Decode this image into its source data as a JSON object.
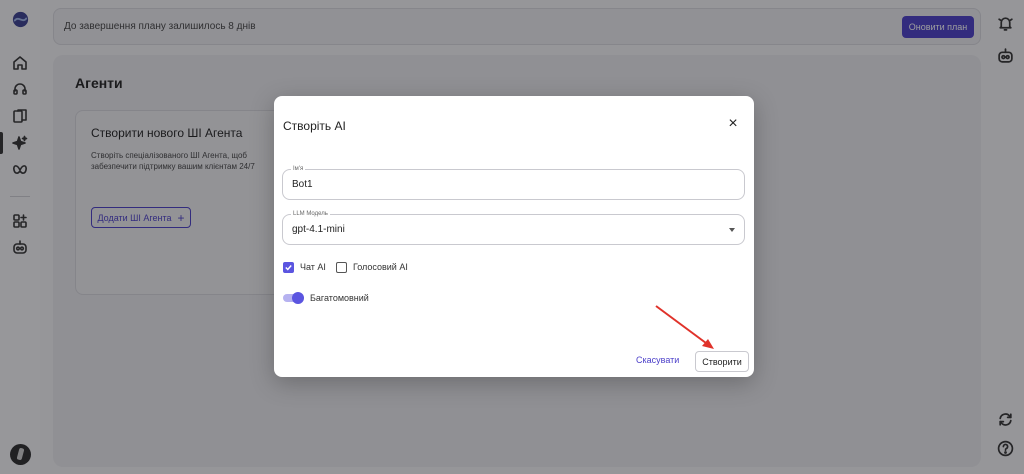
{
  "banner": {
    "text": "До завершення плану залишилось 8 днів",
    "upgrade_label": "Оновити план"
  },
  "sidebar": {
    "items": [
      {
        "icon": "logo-icon"
      },
      {
        "icon": "home-icon"
      },
      {
        "icon": "headset-icon"
      },
      {
        "icon": "documents-icon"
      },
      {
        "icon": "sparkles-icon",
        "active": true
      },
      {
        "icon": "butterfly-icon"
      },
      {
        "icon": "integrations-icon"
      },
      {
        "icon": "bot-icon"
      }
    ]
  },
  "rail": {
    "items": [
      {
        "icon": "notifications-icon"
      },
      {
        "icon": "bot-icon"
      },
      {
        "icon": "refresh-icon"
      },
      {
        "icon": "help-icon"
      }
    ]
  },
  "main": {
    "title": "Агенти",
    "card": {
      "title": "Створити нового ШІ Агента",
      "description": "Створіть спеціалізованого ШІ Агента, щоб забезпечити підтримку вашим клієнтам 24/7",
      "add_button": "Додати ШІ Агента",
      "add_icon": "+"
    }
  },
  "modal": {
    "title": "Створіть AI",
    "close_icon": "×",
    "name_field": {
      "label": "Ім'я",
      "value": "Bot1"
    },
    "model_field": {
      "label": "LLM Модель",
      "value": "gpt-4.1-mini"
    },
    "checkboxes": [
      {
        "label": "Чат AI",
        "checked": true
      },
      {
        "label": "Голосовий AI",
        "checked": false
      }
    ],
    "toggle": {
      "label": "Багатомовний",
      "on": true
    },
    "cancel_label": "Скасувати",
    "create_label": "Створити"
  },
  "colors": {
    "accent": "#4b3fc9",
    "accent_light": "#5b55e0",
    "annotation": "#e0322a"
  }
}
